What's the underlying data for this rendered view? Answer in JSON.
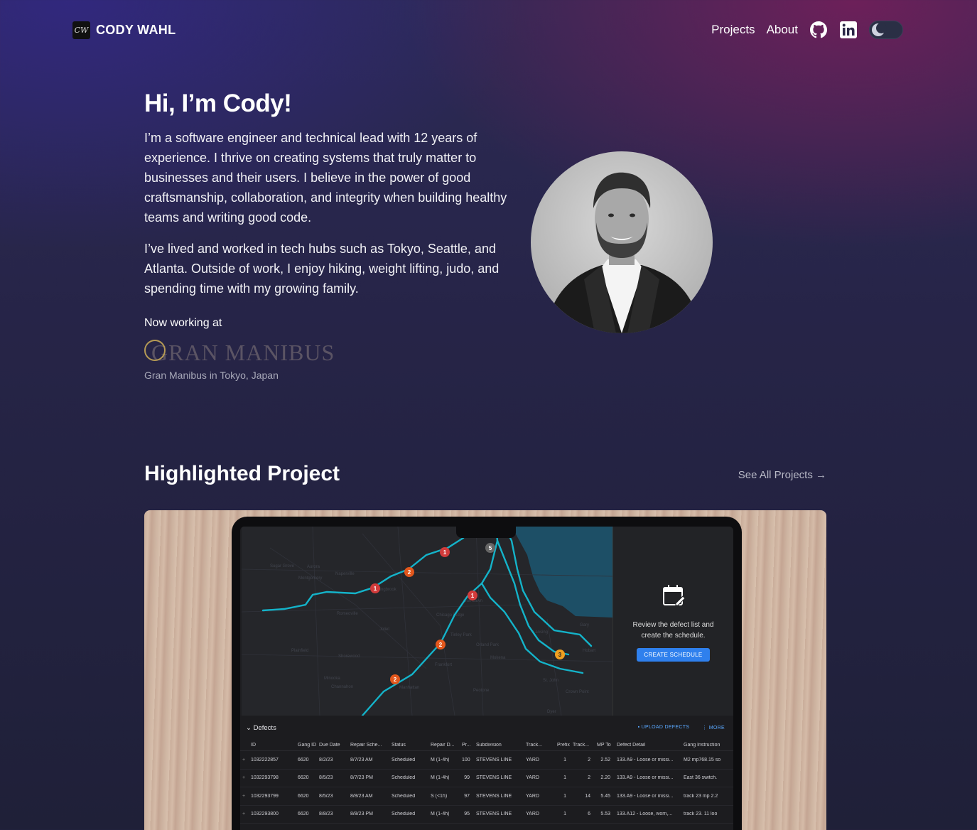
{
  "brand": {
    "logo_text": "CW",
    "name": "CODY WAHL"
  },
  "nav": {
    "links": [
      "Projects",
      "About"
    ],
    "icons": [
      "github-icon",
      "linkedin-icon"
    ],
    "theme_toggle": "dark"
  },
  "hero": {
    "heading": "Hi, I’m Cody!",
    "paragraph1": "I’m a software engineer and technical lead with 12 years of experience. I thrive on creating systems that truly matter to businesses and their users. I believe in the power of good craftsmanship, collaboration, and integrity when building healthy teams and writing good code.",
    "paragraph2": "I’ve lived and worked in tech hubs such as Tokyo, Seattle, and Atlanta. Outside of work, I enjoy hiking, weight lifting, judo, and spending time with my growing family.",
    "now_working": "Now working at",
    "company_logo_text": "GRAN MANIBUS",
    "company_caption": "Gran Manibus in Tokyo, Japan"
  },
  "highlighted": {
    "title": "Highlighted Project",
    "see_all": "See All Projects →"
  },
  "app": {
    "panel_message": "Review the defect list and create the schedule.",
    "panel_button": "CREATE SCHEDULE",
    "table_title": "Defects",
    "upload": "UPLOAD DEFECTS",
    "more": "MORE",
    "columns": [
      "ID",
      "Gang ID",
      "Due Date",
      "Repair Sche...",
      "Status",
      "Repair D...",
      "Pr...",
      "Subdivision",
      "Track...",
      "Prefix",
      "Track...",
      "MP To",
      "Defect Detail",
      "Gang Instruction"
    ],
    "rows": [
      [
        "1032222857",
        "6620",
        "8/2/23",
        "8/7/23 AM",
        "Scheduled",
        "M (1-4h)",
        "100",
        "STEVENS LINE",
        "YARD",
        "1",
        "2",
        "2.52",
        "133.A9 - Loose or missi...",
        "M2 mp768.15 so"
      ],
      [
        "1032293798",
        "6620",
        "8/5/23",
        "8/7/23 PM",
        "Scheduled",
        "M (1-4h)",
        "99",
        "STEVENS LINE",
        "YARD",
        "1",
        "2",
        "2.20",
        "133.A9 - Loose or missi...",
        "East 36 switch."
      ],
      [
        "1032293799",
        "6620",
        "8/5/23",
        "8/8/23 AM",
        "Scheduled",
        "S (<1h)",
        "97",
        "STEVENS LINE",
        "YARD",
        "1",
        "14",
        "5.45",
        "133.A9 - Loose or missi...",
        "track 23 mp 2.2"
      ],
      [
        "1032293800",
        "6620",
        "8/8/23",
        "8/8/23 PM",
        "Scheduled",
        "M (1-4h)",
        "95",
        "STEVENS LINE",
        "YARD",
        "1",
        "6",
        "5.53",
        "133.A12 - Loose, worn,...",
        "track 23. 11 loo"
      ]
    ],
    "markers": [
      "1",
      "2",
      "1",
      "1",
      "2",
      "2",
      "3",
      "5"
    ],
    "map_labels": [
      "Naperville",
      "Aurora",
      "Sugar Grove",
      "Montgomery",
      "Plainfield",
      "Romeoville",
      "Joliet",
      "Bolingbrook",
      "Oak Lawn",
      "Chicago Ridge",
      "Tinley Park",
      "Frankfort",
      "Lansing",
      "Gary",
      "Hobart",
      "Orland Park",
      "Mokena",
      "Shorewood",
      "Minooka",
      "Channahon",
      "Manhattan",
      "Peotone",
      "Crown Point",
      "St. John",
      "Dyer"
    ]
  }
}
